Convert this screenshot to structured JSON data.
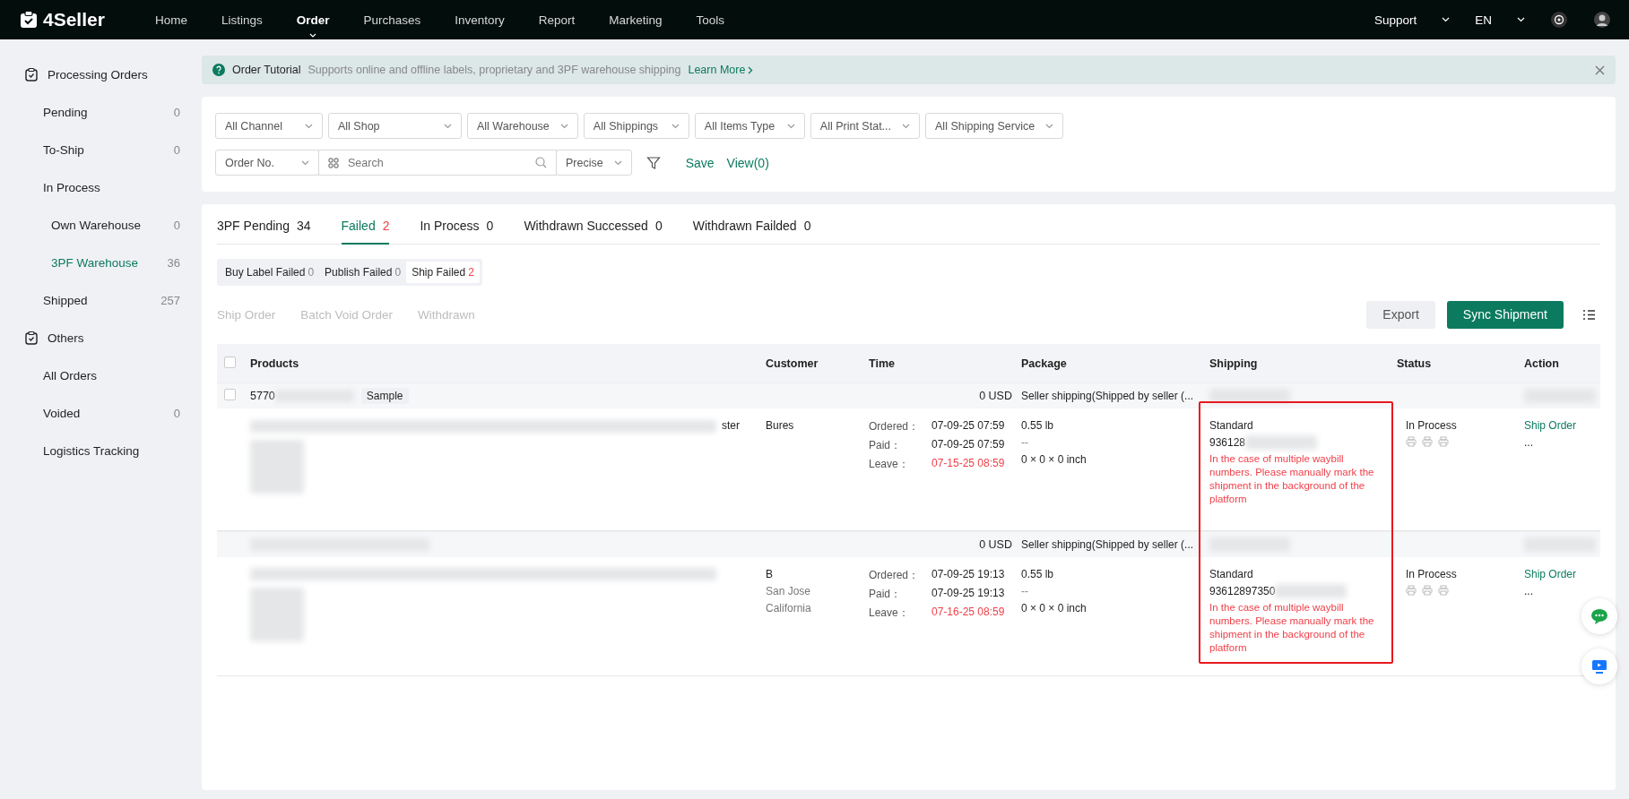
{
  "nav": {
    "logo": "4Seller",
    "items": [
      {
        "label": "Home",
        "selected": false
      },
      {
        "label": "Listings",
        "selected": false
      },
      {
        "label": "Order",
        "selected": true
      },
      {
        "label": "Purchases",
        "selected": false
      },
      {
        "label": "Inventory",
        "selected": false
      },
      {
        "label": "Report",
        "selected": false
      },
      {
        "label": "Marketing",
        "selected": false
      },
      {
        "label": "Tools",
        "selected": false
      }
    ],
    "support": "Support",
    "language": "EN"
  },
  "sidebar": {
    "sections": [
      {
        "title": "Processing Orders",
        "items": [
          {
            "label": "Pending",
            "count": "0",
            "selected": false
          },
          {
            "label": "To-Ship",
            "count": "0",
            "selected": false
          },
          {
            "label": "In Process",
            "selected": false,
            "children": [
              {
                "label": "Own Warehouse",
                "count": "0",
                "selected": false
              },
              {
                "label": "3PF Warehouse",
                "count": "36",
                "selected": true
              }
            ]
          },
          {
            "label": "Shipped",
            "count": "257",
            "selected": false
          }
        ]
      },
      {
        "title": "Others",
        "items": [
          {
            "label": "All Orders",
            "selected": false
          },
          {
            "label": "Voided",
            "count": "0",
            "selected": false
          },
          {
            "label": "Logistics Tracking",
            "selected": false
          }
        ]
      }
    ]
  },
  "banner": {
    "title": "Order Tutorial",
    "text": "Supports online and offline labels, proprietary and 3PF warehouse shipping",
    "link": "Learn More"
  },
  "filters": {
    "dropdowns": [
      "All Channel",
      "All Shop",
      "All Warehouse",
      "All Shippings",
      "All Items Type",
      "All Print Stat...",
      "All Shipping Service"
    ],
    "search": {
      "field": "Order No.",
      "placeholder": "Search",
      "match": "Precise"
    },
    "actions": [
      "Save",
      "View(0)"
    ]
  },
  "tabs": [
    {
      "label": "3PF Pending",
      "count": "34",
      "selected": false
    },
    {
      "label": "Failed",
      "count": "2",
      "selected": true
    },
    {
      "label": "In Process",
      "count": "0",
      "selected": false
    },
    {
      "label": "Withdrawn Successed",
      "count": "0",
      "selected": false
    },
    {
      "label": "Withdrawn Failded",
      "count": "0",
      "selected": false
    }
  ],
  "sub_tabs": [
    {
      "label": "Buy Label Failed",
      "count": "0",
      "selected": false
    },
    {
      "label": "Publish Failed",
      "count": "0",
      "selected": false
    },
    {
      "label": "Ship Failed",
      "count": "2",
      "selected": true
    }
  ],
  "bulk_actions": [
    {
      "label": "Ship Order",
      "disabled": true
    },
    {
      "label": "Batch Void Order",
      "disabled": true
    },
    {
      "label": "Withdrawn",
      "disabled": true
    }
  ],
  "buttons": {
    "export": "Export",
    "sync": "Sync Shipment"
  },
  "table": {
    "all_checked": false,
    "columns": [
      "Products",
      "Customer",
      "Time",
      "Package",
      "Shipping",
      "Status",
      "Action"
    ],
    "orders": [
      {
        "order_no": "5770",
        "checked": false,
        "tag": "Sample",
        "amount": "0 USD",
        "shipping_method": "Seller shipping(Shipped by seller (...",
        "product_fragment": "ster",
        "customer": [
          "Bures"
        ],
        "times": [
          {
            "label": "Ordered：",
            "value": "07-09-25 07:59",
            "overdue": false
          },
          {
            "label": "Paid：",
            "value": "07-09-25 07:59",
            "overdue": false
          },
          {
            "label": "Leave：",
            "value": "07-15-25 08:59",
            "overdue": true
          }
        ],
        "package": [
          "0.55 lb",
          "--",
          "0 × 0 × 0 inch"
        ],
        "carrier": "Standard",
        "tracking": "936128",
        "error": "In the case of multiple waybill numbers. Please manually mark the shipment in the background of the platform",
        "status": "In Process",
        "action": "Ship Order",
        "more": "..."
      },
      {
        "amount": "0 USD",
        "shipping_method": "Seller shipping(Shipped by seller (...",
        "customer": [
          "B",
          "San Jose",
          "California"
        ],
        "times": [
          {
            "label": "Ordered：",
            "value": "07-09-25 19:13",
            "overdue": false
          },
          {
            "label": "Paid：",
            "value": "07-09-25 19:13",
            "overdue": false
          },
          {
            "label": "Leave：",
            "value": "07-16-25 08:59",
            "overdue": true
          }
        ],
        "package": [
          "0.55 lb",
          "--",
          "0 × 0 × 0 inch"
        ],
        "carrier": "Standard",
        "tracking": "93612897350",
        "error": "In the case of multiple waybill numbers. Please manually mark the shipment in the background of the platform",
        "status": "In Process",
        "action": "Ship Order",
        "more": "..."
      }
    ]
  }
}
